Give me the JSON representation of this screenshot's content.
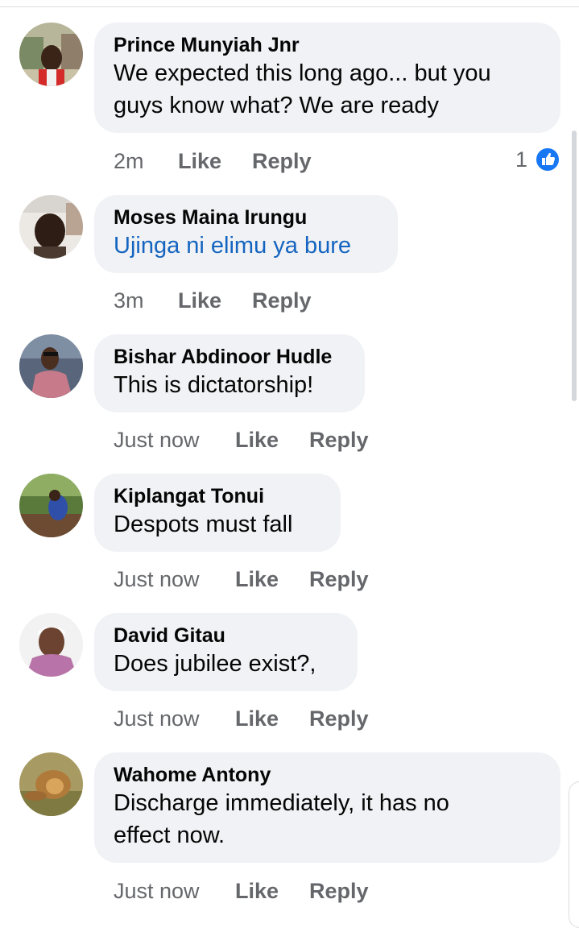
{
  "comments": [
    {
      "author": "Prince Munyiah Jnr",
      "text_lines": [
        "We expected this long ago... but you",
        "guys know what? We are ready"
      ],
      "time": "2m",
      "like_label": "Like",
      "reply_label": "Reply",
      "reaction_count": "1",
      "reaction_icon": "like-icon"
    },
    {
      "author": "Moses Maina Irungu",
      "text_lines": [
        "Ujinga ni elimu ya bure"
      ],
      "time": "3m",
      "like_label": "Like",
      "reply_label": "Reply"
    },
    {
      "author": "Bishar Abdinoor Hudle",
      "text_lines": [
        "This is dictatorship!"
      ],
      "time": "Just now",
      "like_label": "Like",
      "reply_label": "Reply"
    },
    {
      "author": "Kiplangat Tonui",
      "text_lines": [
        "Despots must fall"
      ],
      "time": "Just now",
      "like_label": "Like",
      "reply_label": "Reply"
    },
    {
      "author": "David Gitau",
      "text_lines": [
        "Does jubilee exist?,"
      ],
      "time": "Just now",
      "like_label": "Like",
      "reply_label": "Reply"
    },
    {
      "author": "Wahome Antony",
      "text_lines": [
        "Discharge immediately, it has no",
        "effect now."
      ],
      "time": "Just now",
      "like_label": "Like",
      "reply_label": "Reply"
    }
  ],
  "colors": {
    "bubble": "#f0f2f5",
    "meta_text": "#65676b",
    "link_text": "#1565c0",
    "like_reaction": "#1877f2"
  }
}
